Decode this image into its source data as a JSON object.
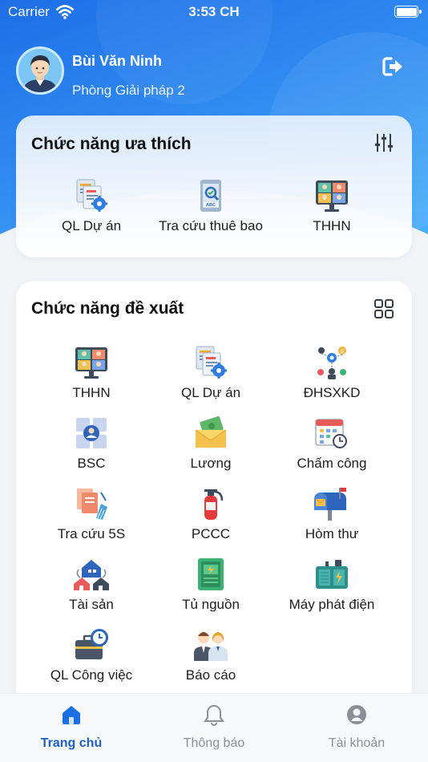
{
  "status_bar": {
    "carrier": "Carrier",
    "time": "3:53 CH"
  },
  "profile": {
    "name": "Bùi Văn Ninh",
    "department": "Phòng Giải pháp 2"
  },
  "favorites": {
    "title": "Chức năng ưa thích",
    "items": [
      {
        "label": "QL Dự án",
        "icon": "project-management-icon"
      },
      {
        "label": "Tra cứu thuê bao",
        "icon": "subscriber-lookup-icon"
      },
      {
        "label": "THHN",
        "icon": "video-conference-icon"
      }
    ]
  },
  "suggested": {
    "title": "Chức năng đề xuất",
    "items": [
      {
        "label": "THHN",
        "icon": "video-conference-icon"
      },
      {
        "label": "QL Dự án",
        "icon": "project-management-icon"
      },
      {
        "label": "ĐHSXKD",
        "icon": "business-operations-icon"
      },
      {
        "label": "BSC",
        "icon": "bsc-icon"
      },
      {
        "label": "Lương",
        "icon": "salary-envelope-icon"
      },
      {
        "label": "Chấm công",
        "icon": "timesheet-calendar-icon"
      },
      {
        "label": "Tra cứu 5S",
        "icon": "5s-lookup-icon"
      },
      {
        "label": "PCCC",
        "icon": "fire-extinguisher-icon"
      },
      {
        "label": "Hòm thư",
        "icon": "mailbox-icon"
      },
      {
        "label": "Tài sản",
        "icon": "assets-houses-icon"
      },
      {
        "label": "Tủ nguồn",
        "icon": "power-cabinet-icon"
      },
      {
        "label": "Máy phát điện",
        "icon": "generator-icon"
      },
      {
        "label": "QL Công việc",
        "icon": "work-briefcase-clock-icon"
      },
      {
        "label": "Báo cáo",
        "icon": "report-people-icon"
      }
    ]
  },
  "tabs": [
    {
      "label": "Trang chủ",
      "icon": "home-icon",
      "active": true
    },
    {
      "label": "Thông báo",
      "icon": "bell-icon",
      "active": false
    },
    {
      "label": "Tài khoản",
      "icon": "account-icon",
      "active": false
    }
  ],
  "colors": {
    "primary": "#1e6ee8",
    "active_tab": "#1c5fc4",
    "inactive_tab": "#8b8f96",
    "background": "#f1f3f7"
  }
}
